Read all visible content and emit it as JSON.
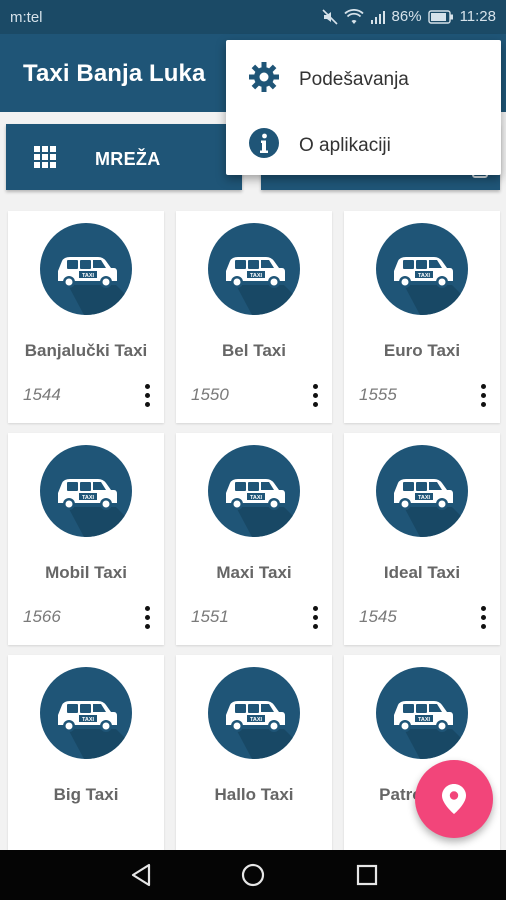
{
  "status_bar": {
    "carrier": "m:tel",
    "battery": "86%",
    "time": "11:28"
  },
  "app_bar": {
    "title": "Taxi Banja Luka"
  },
  "tabs": [
    {
      "label": "MREŽA",
      "icon": "grid-icon",
      "selected": true
    },
    {
      "label": "",
      "icon": "map-icon",
      "selected": false
    }
  ],
  "overflow_menu": {
    "items": [
      {
        "label": "Podešavanja",
        "icon": "gear-icon"
      },
      {
        "label": "O aplikaciji",
        "icon": "info-icon"
      }
    ]
  },
  "taxis": [
    {
      "name": "Banjalučki Taxi",
      "phone": "1544"
    },
    {
      "name": "Bel Taxi",
      "phone": "1550"
    },
    {
      "name": "Euro Taxi",
      "phone": "1555"
    },
    {
      "name": "Mobil Taxi",
      "phone": "1566"
    },
    {
      "name": "Maxi Taxi",
      "phone": "1551"
    },
    {
      "name": "Ideal Taxi",
      "phone": "1545"
    },
    {
      "name": "Big Taxi",
      "phone": ""
    },
    {
      "name": "Hallo Taxi",
      "phone": ""
    },
    {
      "name": "Patrol Taxi",
      "phone": ""
    }
  ],
  "car_badge_text": "TAXI",
  "fab": {
    "icon": "location-pin-icon"
  },
  "navigation": {
    "back": "back-icon",
    "home": "home-icon",
    "recents": "recents-icon"
  },
  "colors": {
    "primary": "#1f5577",
    "status_bar": "#1b4a66",
    "accent": "#f2457a",
    "background": "#f2f2f2"
  }
}
